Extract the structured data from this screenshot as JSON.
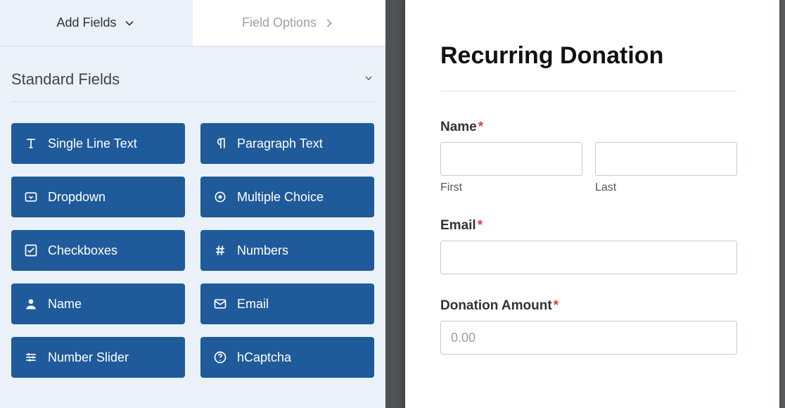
{
  "tabs": {
    "addFields": "Add Fields",
    "fieldOptions": "Field Options"
  },
  "section": {
    "title": "Standard Fields"
  },
  "fields": {
    "singleLineText": "Single Line Text",
    "paragraphText": "Paragraph Text",
    "dropdown": "Dropdown",
    "multipleChoice": "Multiple Choice",
    "checkboxes": "Checkboxes",
    "numbers": "Numbers",
    "name": "Name",
    "email": "Email",
    "numberSlider": "Number Slider",
    "hcaptcha": "hCaptcha"
  },
  "form": {
    "title": "Recurring Donation",
    "nameLabel": "Name",
    "nameFirstSub": "First",
    "nameLastSub": "Last",
    "emailLabel": "Email",
    "donationLabel": "Donation Amount",
    "donationPlaceholder": "0.00",
    "requiredMark": "*"
  }
}
